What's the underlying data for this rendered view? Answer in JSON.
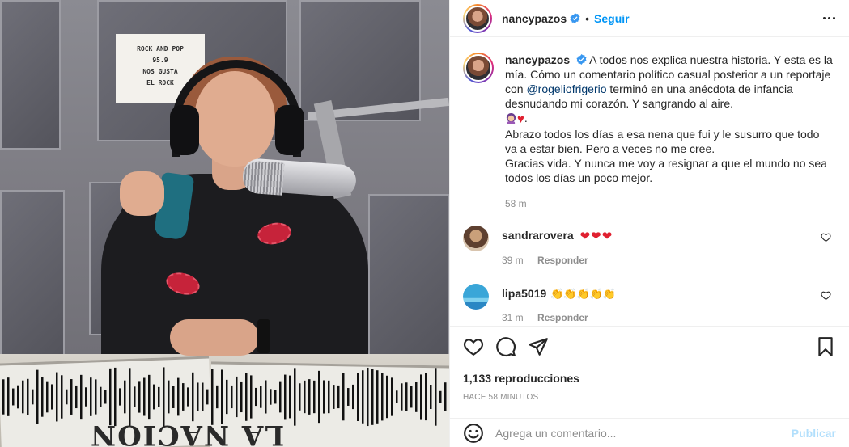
{
  "media": {
    "sign_lines": [
      "ROCK AND POP",
      "95.9",
      "NOS GUSTA",
      "EL ROCK"
    ],
    "newspaper_title": "LA NACION"
  },
  "header": {
    "username": "nancypazos",
    "separator": "•",
    "follow_label": "Seguir"
  },
  "caption": {
    "username": "nancypazos",
    "line1": "A todos nos explica nuestra historia. Y esta es la mía. Cómo un comentario político casual posterior a un reportaje con ",
    "mention": "@rogeliofrigerio",
    "line2": " terminó en una anécdota de infancia desnudando mi corazón. Y sangrando al aire.",
    "emoji_suffix": ".",
    "line3": "Abrazo todos los días a esa nena que fui y le susurro que todo va a estar bien. Pero a veces no me cree.",
    "line4": "Gracias vida. Y nunca me voy a resignar a que el mundo no sea todos los días un poco mejor.",
    "time": "58 m"
  },
  "comments": [
    {
      "username": "sandrarovera",
      "text": "❤❤❤",
      "time": "39 m",
      "reply": "Responder"
    },
    {
      "username": "lipa5019",
      "text": "👏👏👏👏👏",
      "time": "31 m",
      "reply": "Responder"
    }
  ],
  "stats": {
    "views": "1,133 reproducciones",
    "ago": "HACE 58 MINUTOS"
  },
  "add_comment": {
    "placeholder": "Agrega un comentario...",
    "publish_label": "Publicar"
  },
  "colors": {
    "accent": "#0095f6",
    "publish_disabled": "#b2dffc",
    "muted": "#8e8e8e",
    "text": "#262626"
  }
}
